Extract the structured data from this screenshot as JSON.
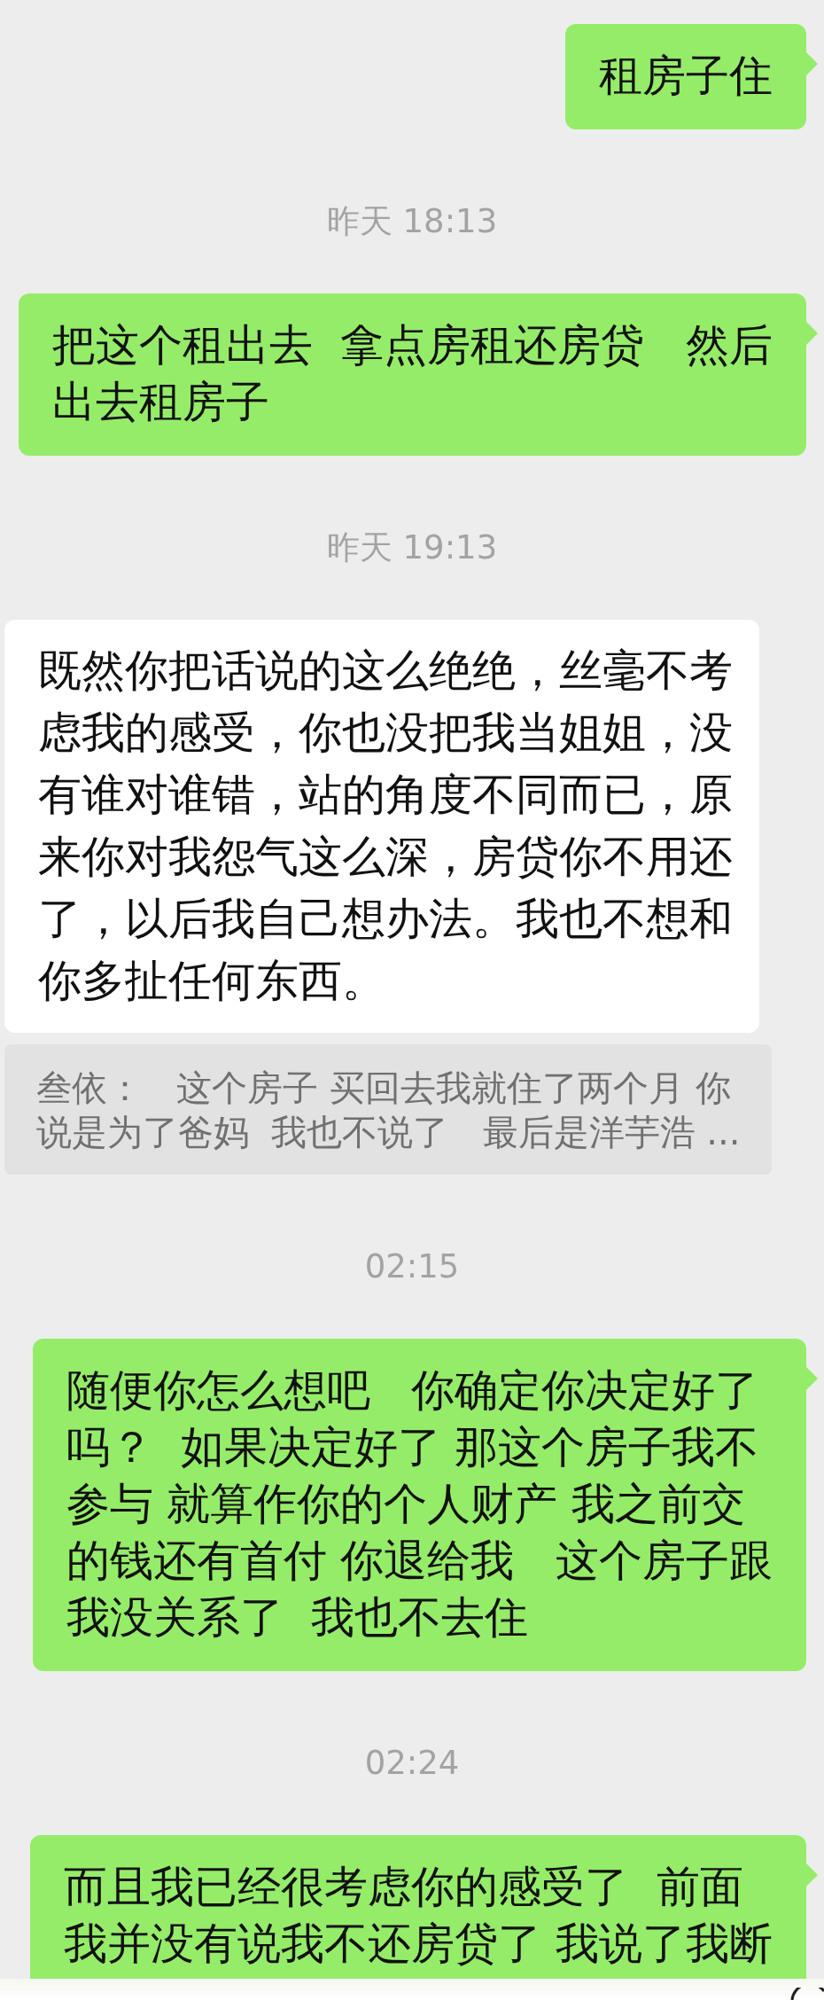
{
  "messages": [
    {
      "kind": "sent",
      "lines": [
        "租房子住"
      ]
    },
    {
      "kind": "time",
      "text": "昨天 18:13"
    },
    {
      "kind": "sent",
      "lines": [
        "把这个租出去  拿点房租还房贷   然后",
        "出去租房子"
      ]
    },
    {
      "kind": "time",
      "text": "昨天 19:13"
    },
    {
      "kind": "received",
      "lines": [
        "既然你把话说的这么绝绝，丝毫不考",
        "虑我的感受，你也没把我当姐姐，没",
        "有谁对谁错，站的角度不同而已，原",
        "来你对我怨气这么深，房贷你不用还",
        "了，以后我自己想办法。我也不想和",
        "你多扯任何东西。"
      ]
    },
    {
      "kind": "quote",
      "lines": [
        "叁依：   这个房子 买回去我就住了两个月 你",
        "说是为了爸妈  我也不说了   最后是洋芋浩 ..."
      ]
    },
    {
      "kind": "time",
      "text": "02:15"
    },
    {
      "kind": "sent",
      "lines": [
        "随便你怎么想吧   你确定你决定好了",
        "吗？  如果决定好了 那这个房子我不",
        "参与 就算作你的个人财产 我之前交",
        "的钱还有首付 你退给我   这个房子跟",
        "我没关系了  我也不去住"
      ]
    },
    {
      "kind": "time",
      "text": "02:24"
    },
    {
      "kind": "sent",
      "lines": [
        "而且我已经很考虑你的感受了  前面",
        "我并没有说我不还房贷了 我说了我断"
      ]
    }
  ]
}
